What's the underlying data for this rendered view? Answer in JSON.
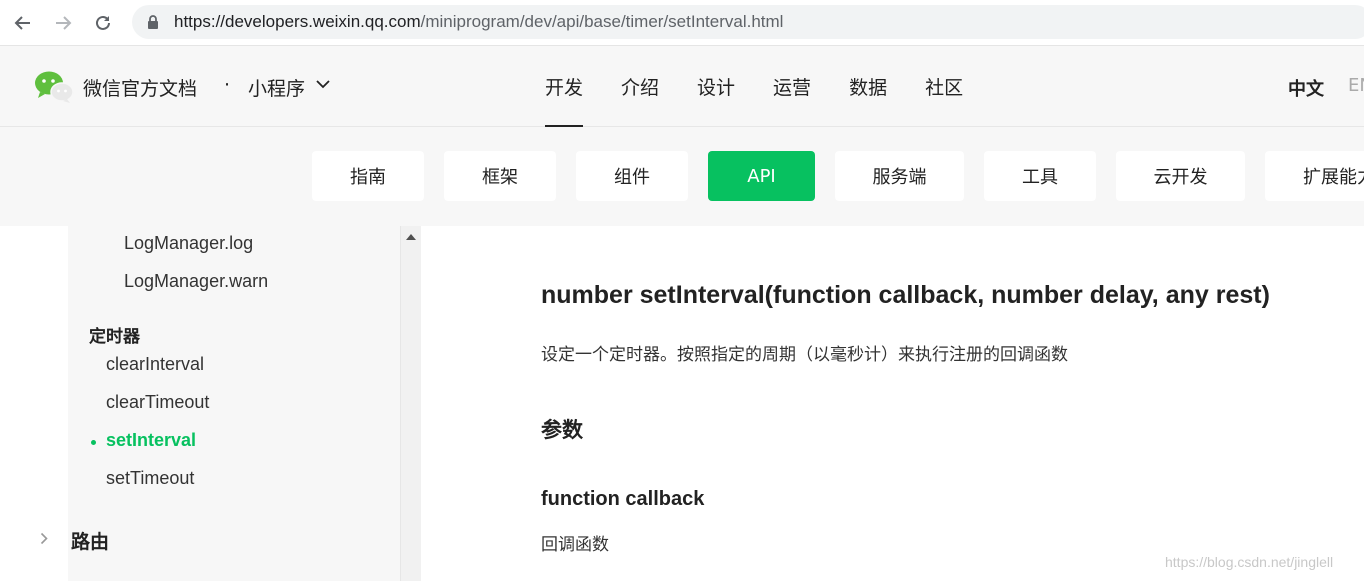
{
  "browser": {
    "url_host": "https://developers.weixin.qq.com",
    "url_path": "/miniprogram/dev/api/base/timer/setInterval.html"
  },
  "header": {
    "site_title": "微信官方文档",
    "separator": "·",
    "product": "小程序",
    "nav": [
      {
        "label": "开发",
        "active": true
      },
      {
        "label": "介绍"
      },
      {
        "label": "设计"
      },
      {
        "label": "运营"
      },
      {
        "label": "数据"
      },
      {
        "label": "社区"
      }
    ],
    "lang_zh": "中文",
    "lang_en": "EN"
  },
  "subnav": [
    {
      "label": "指南"
    },
    {
      "label": "框架"
    },
    {
      "label": "组件"
    },
    {
      "label": "API",
      "active": true
    },
    {
      "label": "服务端"
    },
    {
      "label": "工具"
    },
    {
      "label": "云开发"
    },
    {
      "label": "扩展能力"
    }
  ],
  "sidebar": {
    "items_top": [
      "LogManager.log",
      "LogManager.warn"
    ],
    "section": "定时器",
    "timer_items": [
      "clearInterval",
      "clearTimeout",
      "setInterval",
      "setTimeout"
    ],
    "active_item": "setInterval",
    "next_group": "路由"
  },
  "content": {
    "title": "number setInterval(function callback, number delay, any rest)",
    "description": "设定一个定时器。按照指定的周期（以毫秒计）来执行注册的回调函数",
    "params_heading": "参数",
    "param_name": "function callback",
    "param_desc": "回调函数"
  },
  "watermark": "https://blog.csdn.net/jinglell",
  "colors": {
    "accent": "#07c160"
  }
}
